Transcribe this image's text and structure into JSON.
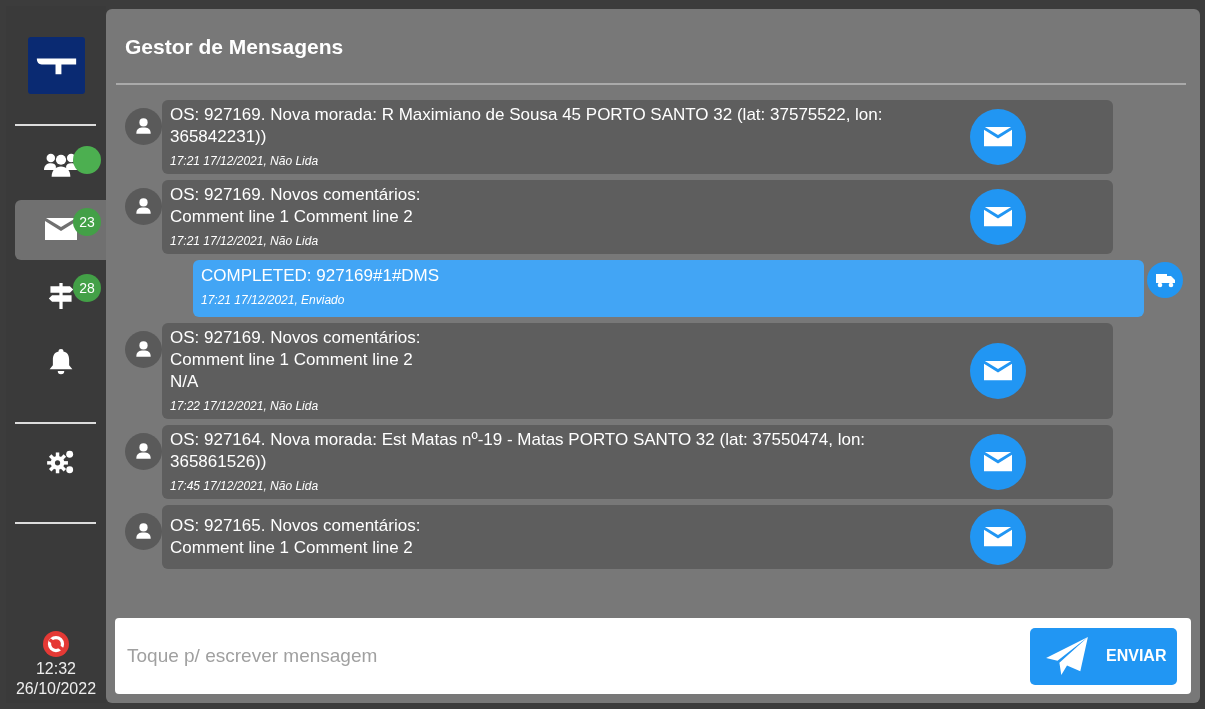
{
  "sidebar": {
    "items": [
      {
        "kind": "team",
        "selected": false,
        "color": "#4caf50"
      },
      {
        "kind": "messages",
        "selected": true,
        "badge": "23"
      },
      {
        "kind": "signpost",
        "selected": false,
        "badge": "28"
      },
      {
        "kind": "bell",
        "selected": false
      },
      {
        "kind": "gears",
        "selected": false
      }
    ],
    "clock": {
      "time": "12:32",
      "date": "26/10/2022"
    }
  },
  "header": {
    "title": "Gestor de Mensagens"
  },
  "messages": [
    {
      "kind": "received",
      "text": "OS: 927169. Nova morada: R Maximiano de Sousa 45 PORTO SANTO 32 (lat: 37575522, lon: 365842231))",
      "meta": "17:21 17/12/2021, Não Lida"
    },
    {
      "kind": "received",
      "text": "OS: 927169. Novos comentários:\nComment line 1 Comment line 2",
      "meta": "17:21 17/12/2021, Não Lida"
    },
    {
      "kind": "sent",
      "text": "COMPLETED: 927169#1#DMS",
      "meta": "17:21 17/12/2021, Enviado"
    },
    {
      "kind": "received",
      "text": "OS: 927169. Novos comentários:\nComment line 1 Comment line 2\nN/A",
      "meta": "17:22 17/12/2021, Não Lida"
    },
    {
      "kind": "received",
      "text": "OS: 927164. Nova morada: Est Matas nº-19 - Matas PORTO SANTO 32 (lat: 37550474, lon: 365861526))",
      "meta": "17:45 17/12/2021, Não Lida"
    },
    {
      "kind": "received",
      "text": "OS: 927165. Novos comentários:\nComment line 1 Comment line 2"
    }
  ],
  "composer": {
    "placeholder": "Toque p/ escrever mensagem",
    "send_label": "ENVIAR"
  }
}
